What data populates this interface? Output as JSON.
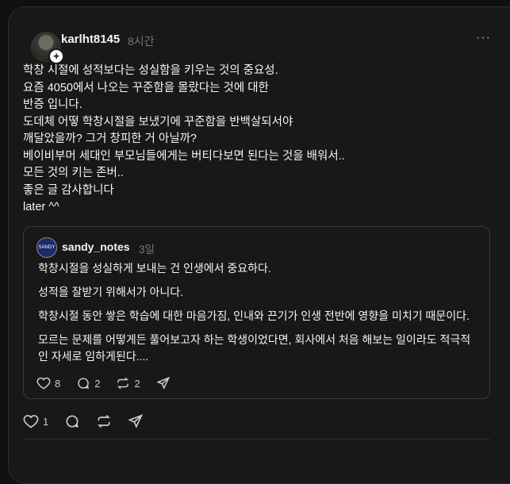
{
  "post": {
    "username": "karlht8145",
    "time": "8시간",
    "more": "···",
    "lines": [
      "학창 시절에 성적보다는 성실함을 키우는 것의 중요성.",
      "요즘 4050에서 나오는 꾸준함을 몰랐다는 것에 대한",
      "반증 입니다.",
      "도데체 어떻 학창시절을 보냈기에 꾸준함을 반백살되서야",
      "깨달았을까? 그거 창피한 거 아닐까?",
      "베이비부머 세대인 부모님들에게는 버티다보면 된다는 것을 배워서..",
      "모든 것의 키는 존버..",
      "좋은 글 감사합니다",
      "later ^^"
    ],
    "likes": "1"
  },
  "quoted": {
    "username": "sandy_notes",
    "time": "3일",
    "avatar_text": "SANDY",
    "p1": "학창시절을 성실하게 보내는 건 인생에서 중요하다.",
    "p2": "성적을 잘받기 위해서가 아니다.",
    "p3": "학창시절 동안 쌓은 학습에 대한 마음가짐, 인내와 끈기가 인생 전반에 영향을 미치기 때문이다.",
    "p4a": "모르는 문제를 어떻게든 풀어보고자 하는 학생이었다면, 회사에서 처음 해보는 일이라도 적극적",
    "p4b": "인 자세로 임하게된다....",
    "likes": "8",
    "replies": "2",
    "reposts": "2"
  }
}
